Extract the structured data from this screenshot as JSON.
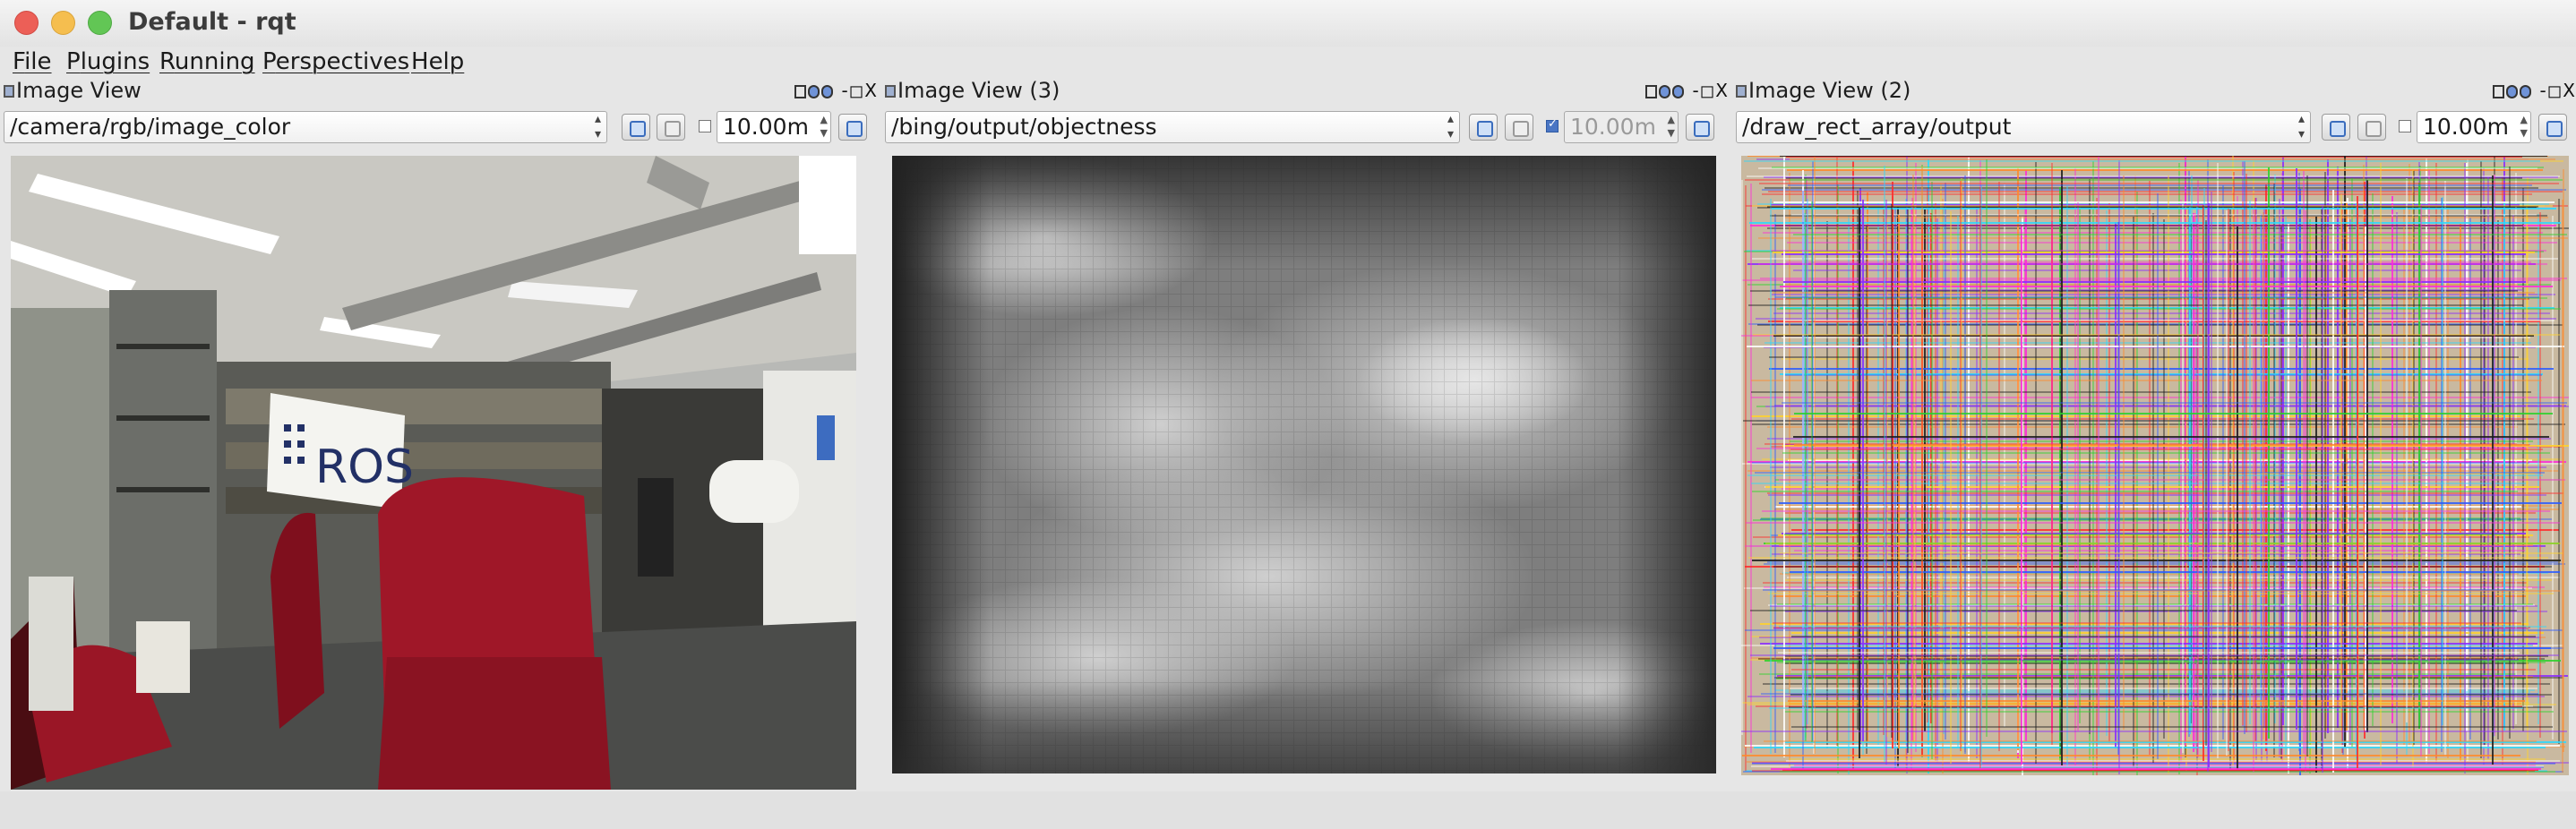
{
  "window": {
    "title": "Default - rqt"
  },
  "menu": [
    "File",
    "Plugins",
    "Running",
    "Perspectives",
    "Help"
  ],
  "panels": [
    {
      "title": "Image View",
      "topic": "/camera/rgb/image_color",
      "timeout": "10.00m",
      "smooth_checked": false,
      "timeout_enabled": true,
      "controls": "-◻X",
      "image": "camera-rgb-office"
    },
    {
      "title": "Image View (3)",
      "topic": "/bing/output/objectness",
      "timeout": "10.00m",
      "smooth_checked": true,
      "timeout_enabled": false,
      "controls": "-◻X",
      "image": "objectness-heatmap"
    },
    {
      "title": "Image View (2)",
      "topic": "/draw_rect_array/output",
      "timeout": "10.00m",
      "smooth_checked": false,
      "timeout_enabled": true,
      "controls": "-◻X",
      "image": "rect-array-overlay"
    }
  ],
  "icons": [
    "close-icon",
    "minimize-icon",
    "maximize-icon",
    "refresh-icon",
    "save-icon",
    "dock-icon"
  ],
  "camera_sign": "ROS",
  "colors": {
    "close": "#ec5f57",
    "minimize": "#f5be4f",
    "maximize": "#62c655",
    "accent": "#3b6dbd"
  }
}
